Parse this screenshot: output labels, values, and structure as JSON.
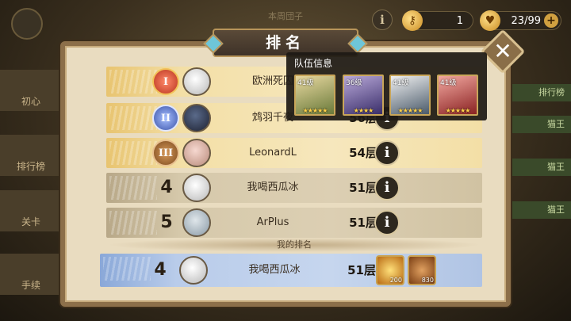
{
  "background": {
    "top_title": "本周団子",
    "left_tabs": [
      "初心",
      "排行榜",
      "关卡",
      "手续"
    ],
    "right_tabs": [
      "排行榜",
      "猫王",
      "猫王",
      "猫王"
    ]
  },
  "currency": {
    "keys": "1",
    "stamina": "23/99"
  },
  "dialog": {
    "title": "排名",
    "my_rank_label": "我的排名"
  },
  "rankings": [
    {
      "rank": "1",
      "name": "欧洲死囚",
      "floor": "",
      "badge": "I"
    },
    {
      "rank": "2",
      "name": "鸩羽千夜",
      "floor": "56层",
      "badge": "II"
    },
    {
      "rank": "3",
      "name": "LeonardL",
      "floor": "54层",
      "badge": "III"
    },
    {
      "rank": "4",
      "name": "我喝西瓜冰",
      "floor": "51层"
    },
    {
      "rank": "5",
      "name": "ArPlus",
      "floor": "51层"
    }
  ],
  "my_row": {
    "rank": "4",
    "name": "我喝西瓜冰",
    "floor": "51层",
    "rewards": [
      {
        "icon": "diamond-icon",
        "count": "200"
      },
      {
        "icon": "coin-icon",
        "count": "830"
      }
    ]
  },
  "team_popup": {
    "title": "队伍信息",
    "heroes": [
      {
        "level": "41级",
        "stars": "★★★★★"
      },
      {
        "level": "36级",
        "stars": "★★★★"
      },
      {
        "level": "41级",
        "stars": "★★★★★"
      },
      {
        "level": "41级",
        "stars": "★★★★★"
      }
    ]
  },
  "icons": {
    "info": "i",
    "close": "✕",
    "plus": "+"
  }
}
